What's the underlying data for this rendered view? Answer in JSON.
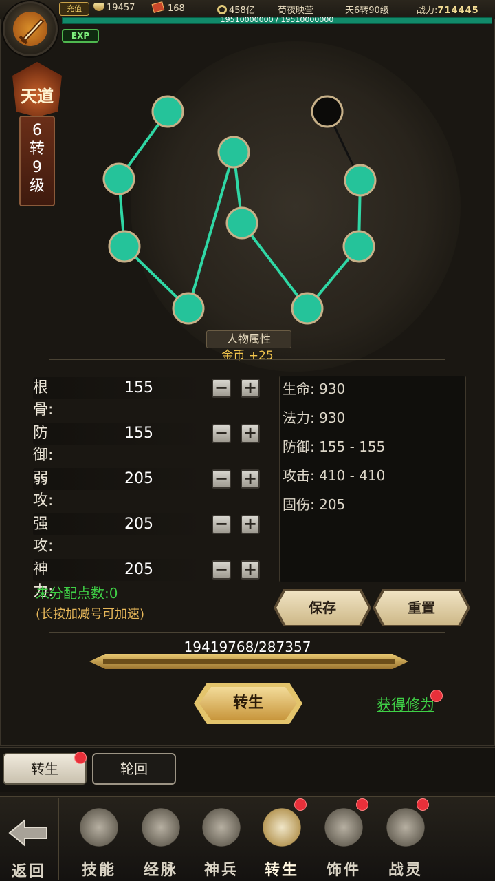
{
  "topbar": {
    "recharge_label": "充值",
    "silver_amount": "19457",
    "ticket_amount": "168",
    "coin_amount": "458亿",
    "event_label": "荀夜映萱",
    "realm_label": "天6转90级",
    "power_label": "战力:",
    "power_value": "714445"
  },
  "exp": {
    "tag": "EXP",
    "progress_text": "19510000000 / 19510000000",
    "progress": 1.0
  },
  "rank": {
    "title": "天道",
    "level_text": "6\n转\n9\n级"
  },
  "section": {
    "title": "人物属性",
    "gold_bonus": "金币 +25"
  },
  "attributes": [
    {
      "label": "根骨:",
      "value": "155"
    },
    {
      "label": "防御:",
      "value": "155"
    },
    {
      "label": "弱攻:",
      "value": "205"
    },
    {
      "label": "强攻:",
      "value": "205"
    },
    {
      "label": "神力:",
      "value": "205"
    }
  ],
  "buttons": {
    "minus": "−",
    "plus": "+",
    "save": "保存",
    "reset": "重置",
    "rebirth": "转生",
    "get_cultivation": "获得修为"
  },
  "stats": [
    "生命: 930",
    "法力: 930",
    "防御: 155 - 155",
    "攻击: 410 - 410",
    "固伤: 205"
  ],
  "unallocated": "未分配点数:0",
  "hint": "(长按加减号可加速)",
  "rebirth_progress": {
    "text": "19419768/287357"
  },
  "subtabs": [
    "转生",
    "轮回"
  ],
  "nav": {
    "back": "返回",
    "items": [
      {
        "label": "技能",
        "icon": "skill-icon"
      },
      {
        "label": "经脉",
        "icon": "meridian-icon"
      },
      {
        "label": "神兵",
        "icon": "weapon-icon"
      },
      {
        "label": "转生",
        "icon": "rebirth-icon"
      },
      {
        "label": "饰件",
        "icon": "accessory-icon"
      },
      {
        "label": "战灵",
        "icon": "spirit-icon"
      }
    ]
  },
  "colors": {
    "accent_green": "#3fd046",
    "gold": "#f2c54d",
    "jade": "#2fc9a0",
    "red_dot": "#e8303a"
  }
}
